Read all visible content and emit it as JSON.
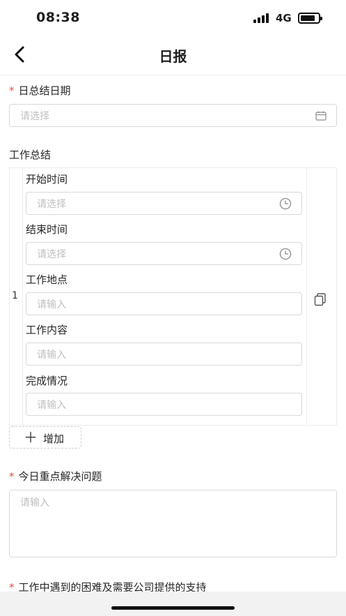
{
  "status_bar": {
    "time": "08:38",
    "network": "4G",
    "battery_level": 0.85
  },
  "nav": {
    "title": "日报",
    "back_icon": "chevron-left-icon"
  },
  "required_mark": "*",
  "summary_date": {
    "label": "日总结日期",
    "placeholder": "请选择",
    "icon": "calendar-icon"
  },
  "work_summary": {
    "label": "工作总结",
    "row_index": "1",
    "copy_icon": "copy-icon",
    "fields": {
      "start_time": {
        "label": "开始时间",
        "placeholder": "请选择",
        "icon": "clock-icon"
      },
      "end_time": {
        "label": "结束时间",
        "placeholder": "请选择",
        "icon": "clock-icon"
      },
      "location": {
        "label": "工作地点",
        "placeholder": "请输入"
      },
      "content": {
        "label": "工作内容",
        "placeholder": "请输入"
      },
      "completion": {
        "label": "完成情况",
        "placeholder": "请输入"
      }
    },
    "add_button": {
      "icon": "plus-icon",
      "label": "增加"
    }
  },
  "key_issues": {
    "label": "今日重点解决问题",
    "placeholder": "请输入"
  },
  "difficulties": {
    "label": "工作中遇到的困难及需要公司提供的支持"
  }
}
